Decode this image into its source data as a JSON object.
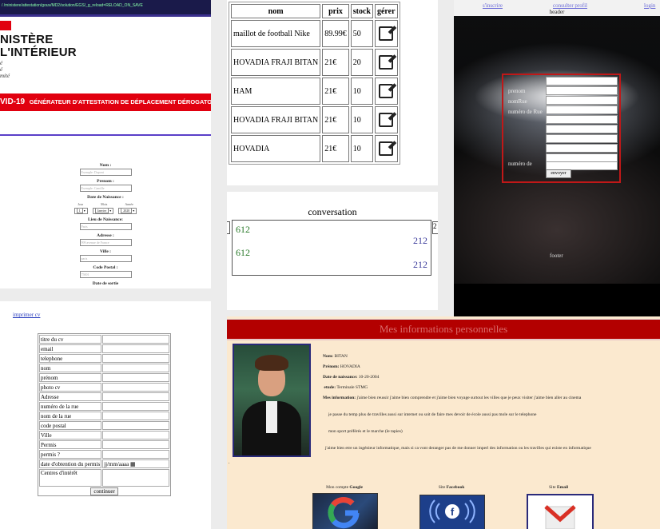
{
  "attestation": {
    "url": "/ /ministere/attestation/gouv/MD2/solution/EGS/_g_reload=RELOAD_ON_SAVE",
    "ministere_line1": "NISTÈRE",
    "ministere_line2": "L'INTÉRIEUR",
    "motto": [
      "é",
      "é",
      "mité"
    ],
    "covid_label": "VID-19",
    "generator_label": "GÉNÉRATEUR D'ATTESTATION DE DÉPLACEMENT DÉROGATO",
    "fields": [
      {
        "label": "Nom :",
        "placeholder": "Exemple: Dupont"
      },
      {
        "label": "Prenom :",
        "placeholder": "Exemple: Camille"
      }
    ],
    "dob_label": "Date de Naissance :",
    "dob_heads": [
      "Jour",
      "Mois",
      "Année"
    ],
    "dob_values": [
      "1",
      "Janvier",
      "2020"
    ],
    "fields2": [
      {
        "label": "Lieu de Naissance:",
        "placeholder": "Paris"
      },
      {
        "label": "Adresse :",
        "placeholder": "999 avenue de France"
      },
      {
        "label": "Ville :",
        "placeholder": "paris"
      },
      {
        "label": "Code Postal :",
        "placeholder": "75001"
      }
    ],
    "cut_label": "Date de sortie"
  },
  "products": {
    "headers": [
      "nom",
      "prix",
      "stock",
      "gérer"
    ],
    "rows": [
      [
        "maillot de football Nike",
        "89.99€",
        "50"
      ],
      [
        "HOVADIA FRAJI BITAN",
        "21€",
        "20"
      ],
      [
        "HAM",
        "21€",
        "10"
      ],
      [
        "HOVADIA FRAJI BITAN",
        "21€",
        "10"
      ],
      [
        "HOVADIA",
        "21€",
        "10"
      ]
    ]
  },
  "conversation": {
    "title": "conversation",
    "messages": [
      {
        "side": "left",
        "text": "612"
      },
      {
        "side": "right",
        "text": "212"
      },
      {
        "side": "left",
        "text": "612"
      },
      {
        "side": "right",
        "text": "212"
      }
    ],
    "right_nub": "2"
  },
  "stadium": {
    "nav": [
      "s'inscrire",
      "consulter profil",
      "login"
    ],
    "header": "header",
    "labels": [
      "prenom",
      "nomRue",
      "numéro de Rue",
      "",
      "",
      "",
      "",
      "",
      "",
      "numéro de"
    ],
    "submit": "envoyer",
    "footer": "footer"
  },
  "cv": {
    "link": "imprimer cv",
    "rows": [
      "titre du cv",
      "email",
      "telephone",
      "nom",
      "prénom",
      "photo cv",
      "Adresse",
      "numéro de la rue",
      "nom de la rue",
      "code postal",
      "Ville",
      "Permis",
      "permis ?",
      "date d'obtention du permis",
      "Centres d'intérêt"
    ],
    "date_placeholder": "jj/mm/aaaa",
    "submit": "continuer"
  },
  "personal": {
    "title": "Mes informations personnelles",
    "lines": [
      {
        "key": "Nom:",
        "val": "BITAN"
      },
      {
        "key": "Prénom:",
        "val": "HOVADIA"
      },
      {
        "key": "Date de naissance:",
        "val": "10-20-2004"
      },
      {
        "key": "etude:",
        "val": "Terminale STMG"
      },
      {
        "key": "Mes information:",
        "val": "j'aime bien reussir j'aime bien comprendre et j'aime bien voyage surtout les villes que je peux visiter j'aime bien aller au cinema"
      }
    ],
    "para1": "je passe du temp plus de travilles aussi sur internet ou soit de faire mes devoir de école aussi pas mole sur le telephone",
    "para2": "mon sport préférés et le marche (le tapies)",
    "para3": "j'aime bien etre un ingénieur informatique, mais si ca vont deranger pas de me donner imperl des information ou les travilles qui existe en informatique",
    "dot": ".",
    "services": [
      {
        "prefix": "Mon compte",
        "name": "Google"
      },
      {
        "prefix": "Site",
        "name": "Facebook"
      },
      {
        "prefix": "Site",
        "name": "Email"
      }
    ]
  }
}
